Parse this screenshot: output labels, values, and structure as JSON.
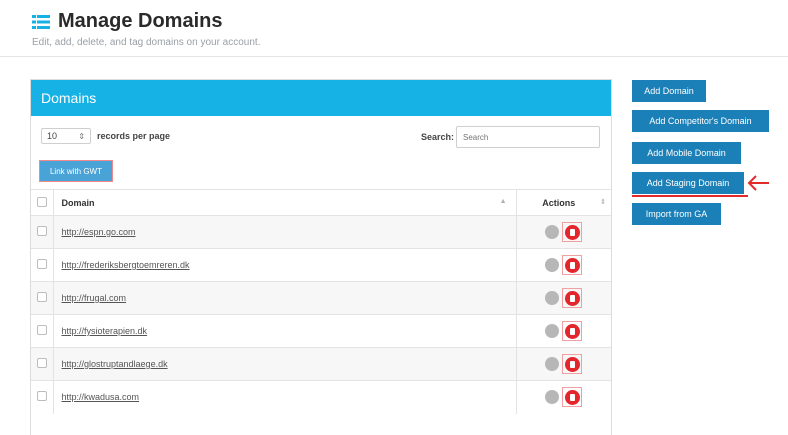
{
  "header": {
    "title": "Manage Domains",
    "subtitle": "Edit, add, delete, and tag domains on your account."
  },
  "panel": {
    "title": "Domains",
    "page_size_value": "10",
    "page_size_caret": "⇕",
    "records_per_page_label": "records per page",
    "search_label": "Search:",
    "search_placeholder": "Search",
    "gwt_button_label": "Link with GWT"
  },
  "table": {
    "headers": {
      "domain": "Domain",
      "actions": "Actions"
    },
    "rows": [
      {
        "domain": "http://espn.go.com"
      },
      {
        "domain": "http://frederiksbergtoemreren.dk"
      },
      {
        "domain": "http://frugal.com"
      },
      {
        "domain": "http://fysioterapien.dk"
      },
      {
        "domain": "http://glostruptandlaege.dk"
      },
      {
        "domain": "http://kwadusa.com"
      }
    ]
  },
  "sidebar_buttons": {
    "add_domain": "Add Domain",
    "add_competitor": "Add Competitor's Domain",
    "add_mobile": "Add Mobile Domain",
    "add_staging": "Add Staging Domain",
    "import_ga": "Import from GA"
  },
  "colors": {
    "panel_header": "#16b2e6",
    "button_blue": "#1b7fb8",
    "delete_red": "#e3262c",
    "annotation_red": "#e12b2b"
  },
  "icons": [
    "list-icon",
    "sort-icon",
    "edit-icon",
    "delete-icon",
    "arrow-left-icon"
  ]
}
